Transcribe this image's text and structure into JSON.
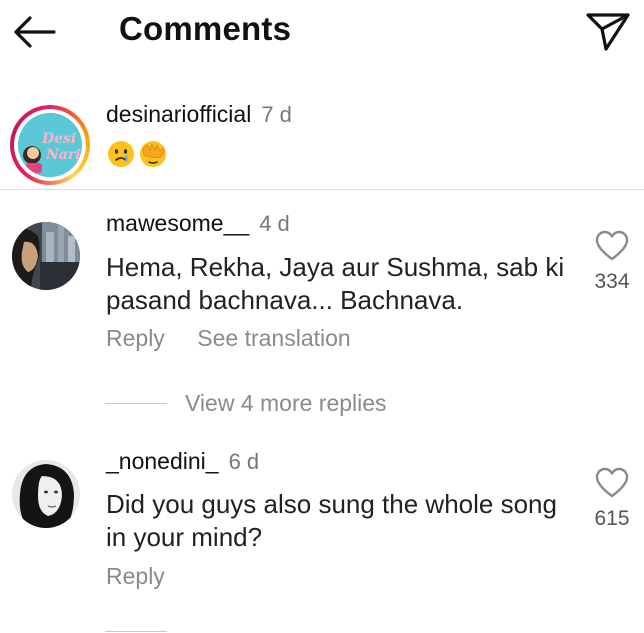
{
  "header": {
    "title": "Comments"
  },
  "caption": {
    "username": "desinariofficial",
    "age": "7 d",
    "avatar_text": "Desi Nari",
    "emojis": [
      "crying-face-emoji",
      "face-with-hand-over-eyes-emoji"
    ]
  },
  "comments": [
    {
      "username": "mawesome__",
      "age": "4 d",
      "text_line1": "Hema, Rekha, Jaya aur Sushma, sab ki",
      "text_line2": "pasand bachnava... Bachnava.",
      "likes": "334",
      "reply_label": "Reply",
      "translate_label": "See translation",
      "view_replies": "View 4 more replies"
    },
    {
      "username": "_nonedini_",
      "age": "6 d",
      "text_line1": "Did you guys also sung the whole song",
      "text_line2": "in your mind?",
      "likes": "615",
      "reply_label": "Reply"
    }
  ],
  "colors": {
    "text": "#111111",
    "muted": "#8a8a8a",
    "divider": "#dcdcdc",
    "ring": "#e91e63"
  }
}
